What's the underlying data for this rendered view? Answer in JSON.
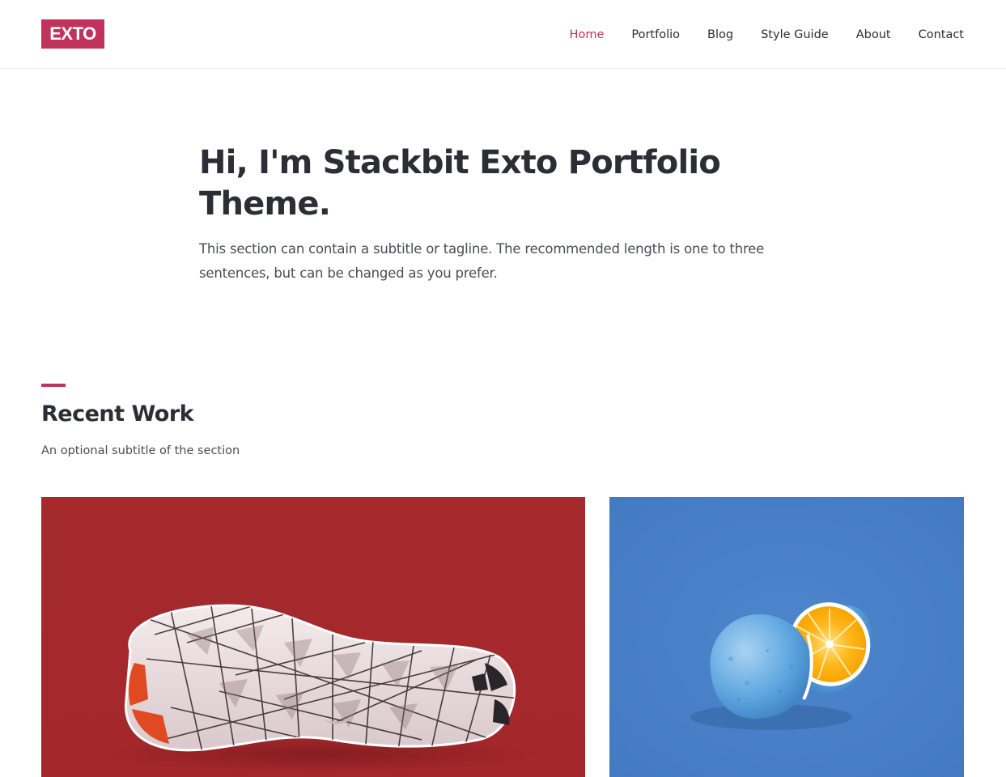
{
  "header": {
    "logo": "EXTO",
    "nav": [
      {
        "label": "Home",
        "active": true
      },
      {
        "label": "Portfolio",
        "active": false
      },
      {
        "label": "Blog",
        "active": false
      },
      {
        "label": "Style Guide",
        "active": false
      },
      {
        "label": "About",
        "active": false
      },
      {
        "label": "Contact",
        "active": false
      }
    ]
  },
  "hero": {
    "title": "Hi, I'm Stackbit Exto Portfolio Theme.",
    "subtitle": "This section can contain a subtitle or tagline. The recommended length is one to three sentences, but can be changed as you prefer."
  },
  "recent_work": {
    "title": "Recent Work",
    "subtitle": "An optional subtitle of the section",
    "items": [
      {
        "image": "sneaker-sole-photo",
        "background": "#a72b2f"
      },
      {
        "image": "blue-painted-orange-photo",
        "background": "#4a80c8"
      }
    ]
  },
  "colors": {
    "accent": "#c0335c",
    "text": "#2b2e34",
    "muted": "#4a4d55",
    "border": "#e9eaeb"
  }
}
